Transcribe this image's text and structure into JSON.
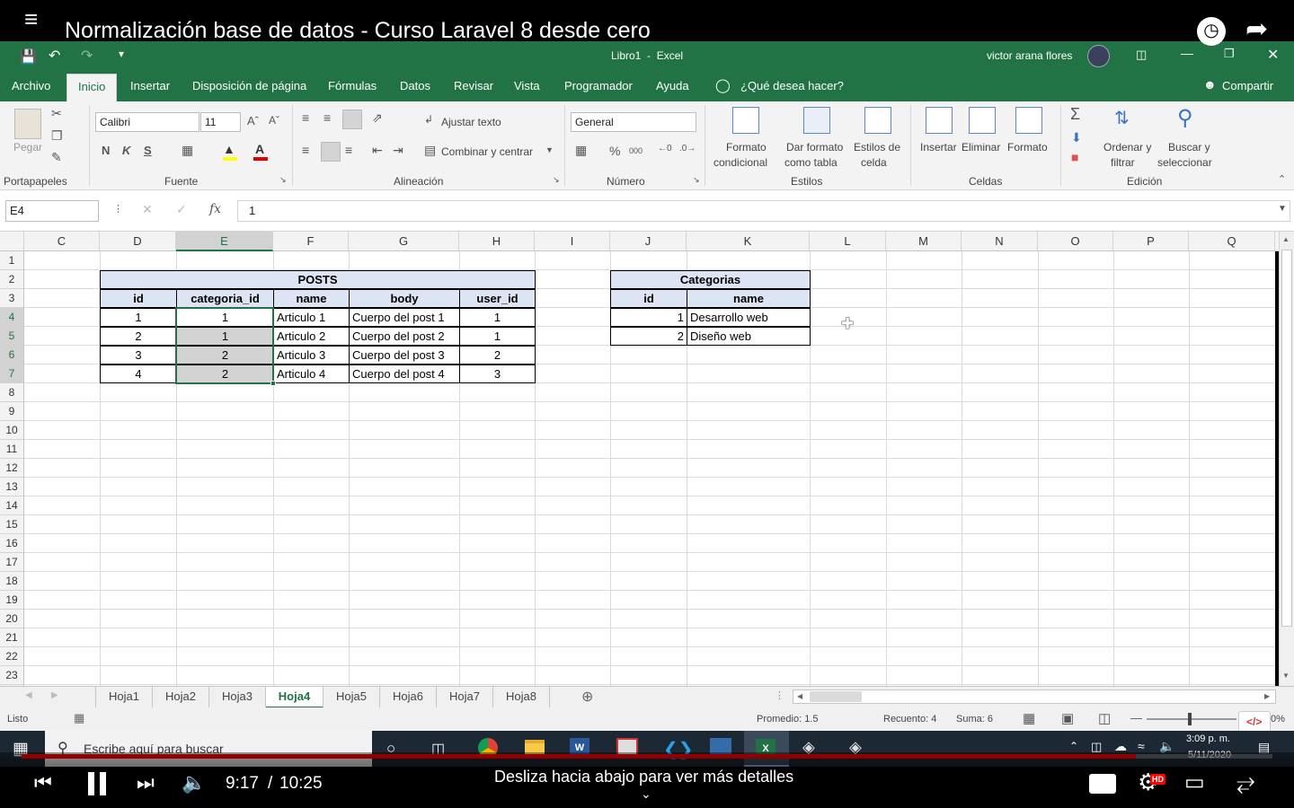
{
  "video": {
    "title": "Normalización base de datos - Curso Laravel 8 desde cero",
    "time_current": "9:17",
    "time_separator": "/",
    "time_total": "10:25",
    "hint": "Desliza hacia abajo para ver más detalles",
    "progress": 0.891,
    "hd_badge": "HD"
  },
  "excel": {
    "window_title": "Libro1  -  Excel",
    "user": "victor arana flores",
    "menu": [
      "Archivo",
      "Inicio",
      "Insertar",
      "Disposición de página",
      "Fórmulas",
      "Datos",
      "Revisar",
      "Vista",
      "Programador",
      "Ayuda"
    ],
    "tell_me": "¿Qué desea hacer?",
    "share": "Compartir",
    "ribbon": {
      "paste": "Pegar",
      "font_name": "Calibri",
      "font_size": "11",
      "bold": "N",
      "italic": "K",
      "underline": "S",
      "wrap_text": "Ajustar texto",
      "merge_center": "Combinar y centrar",
      "number_format": "General",
      "percent": "%",
      "thousands": "000",
      "cond_format_1": "Formato",
      "cond_format_2": "condicional",
      "table_format_1": "Dar formato",
      "table_format_2": "como tabla",
      "cell_styles_1": "Estilos de",
      "cell_styles_2": "celda",
      "insert": "Insertar",
      "delete": "Eliminar",
      "format": "Formato",
      "sort_1": "Ordenar y",
      "sort_2": "filtrar",
      "find_1": "Buscar y",
      "find_2": "seleccionar",
      "groups": {
        "clipboard": "Portapapeles",
        "font": "Fuente",
        "alignment": "Alineación",
        "number": "Número",
        "styles": "Estilos",
        "cells": "Celdas",
        "editing": "Edición"
      }
    },
    "name_box": "E4",
    "formula": "1",
    "fx": "fx",
    "columns": [
      "C",
      "D",
      "E",
      "F",
      "G",
      "H",
      "I",
      "J",
      "K",
      "L",
      "M",
      "N",
      "O",
      "P",
      "Q"
    ],
    "rows": [
      "1",
      "2",
      "3",
      "4",
      "5",
      "6",
      "7",
      "8",
      "9",
      "10",
      "11",
      "12",
      "13",
      "14",
      "15",
      "16",
      "17",
      "18",
      "19",
      "20",
      "21",
      "22",
      "23"
    ],
    "posts": {
      "title": "POSTS",
      "headers": [
        "id",
        "categoria_id",
        "name",
        "body",
        "user_id"
      ],
      "rows": [
        [
          "1",
          "1",
          "Articulo 1",
          "Cuerpo del post 1",
          "1"
        ],
        [
          "2",
          "1",
          "Articulo 2",
          "Cuerpo del post 2",
          "1"
        ],
        [
          "3",
          "2",
          "Articulo 3",
          "Cuerpo del post 3",
          "2"
        ],
        [
          "4",
          "2",
          "Articulo 4",
          "Cuerpo del post 4",
          "3"
        ]
      ]
    },
    "categorias": {
      "title": "Categorias",
      "headers": [
        "id",
        "name"
      ],
      "rows": [
        [
          "1",
          "Desarrollo web"
        ],
        [
          "2",
          "Diseño web"
        ]
      ]
    },
    "sheets": [
      "Hoja1",
      "Hoja2",
      "Hoja3",
      "Hoja4",
      "Hoja5",
      "Hoja6",
      "Hoja7",
      "Hoja8"
    ],
    "active_sheet": "Hoja4",
    "status": {
      "ready": "Listo",
      "average": "Promedio: 1.5",
      "count": "Recuento: 4",
      "sum": "Suma: 6",
      "zoom": "0%"
    }
  },
  "taskbar": {
    "search": "Escribe aquí para buscar",
    "time": "3:09 p. m.",
    "date": "5/11/2020"
  }
}
